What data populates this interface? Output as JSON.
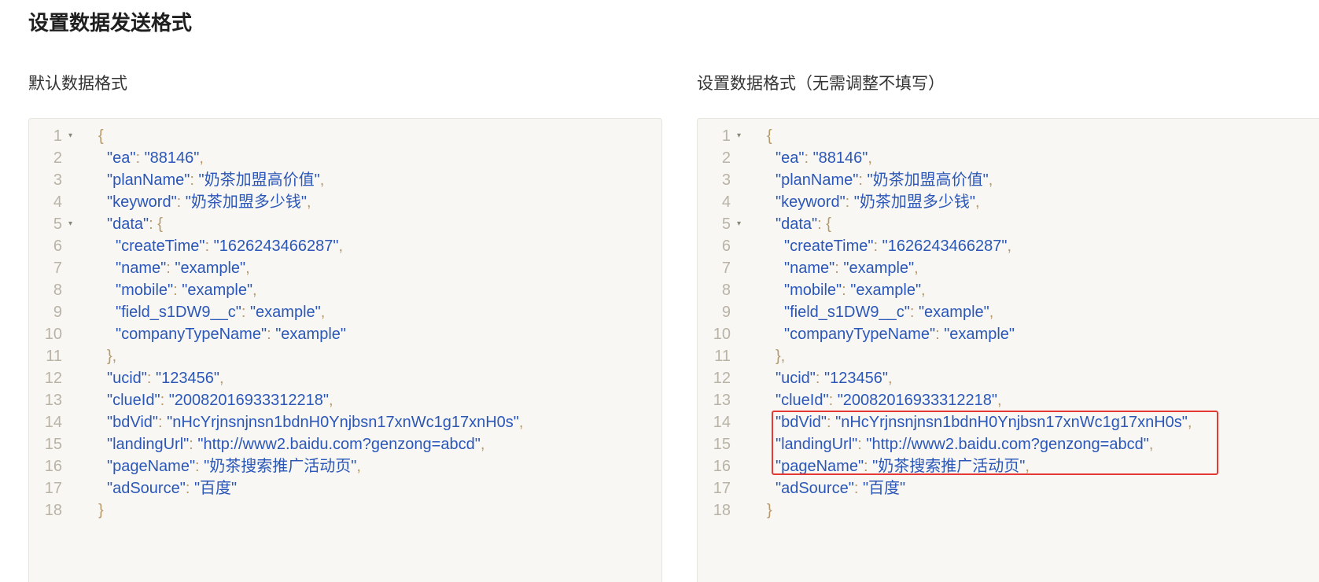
{
  "page": {
    "title": "设置数据发送格式"
  },
  "left_panel": {
    "label": "默认数据格式"
  },
  "right_panel": {
    "label": "设置数据格式（无需调整不填写）"
  },
  "highlight": {
    "color": "#e53935",
    "lines": [
      14,
      15,
      16
    ]
  },
  "colors": {
    "key": "#2b57b8",
    "punctuation": "#b79a6a",
    "line_number": "#b9b3a6",
    "editor_bg": "#f8f7f4"
  },
  "code_lines": [
    {
      "n": "1",
      "indent": 0,
      "fold": true,
      "key": "",
      "sep": "",
      "value": "",
      "open": "{",
      "trail": ""
    },
    {
      "n": "2",
      "indent": 1,
      "fold": false,
      "key": "\"ea\"",
      "sep": ": ",
      "value": "\"88146\"",
      "open": "",
      "trail": ","
    },
    {
      "n": "3",
      "indent": 1,
      "fold": false,
      "key": "\"planName\"",
      "sep": ": ",
      "value": "\"奶茶加盟高价值\"",
      "open": "",
      "trail": ","
    },
    {
      "n": "4",
      "indent": 1,
      "fold": false,
      "key": "\"keyword\"",
      "sep": ": ",
      "value": "\"奶茶加盟多少钱\"",
      "open": "",
      "trail": ","
    },
    {
      "n": "5",
      "indent": 1,
      "fold": true,
      "key": "\"data\"",
      "sep": ": ",
      "value": "",
      "open": "{",
      "trail": ""
    },
    {
      "n": "6",
      "indent": 2,
      "fold": false,
      "key": "\"createTime\"",
      "sep": ": ",
      "value": "\"1626243466287\"",
      "open": "",
      "trail": ","
    },
    {
      "n": "7",
      "indent": 2,
      "fold": false,
      "key": "\"name\"",
      "sep": ": ",
      "value": "\"example\"",
      "open": "",
      "trail": ","
    },
    {
      "n": "8",
      "indent": 2,
      "fold": false,
      "key": "\"mobile\"",
      "sep": ": ",
      "value": "\"example\"",
      "open": "",
      "trail": ","
    },
    {
      "n": "9",
      "indent": 2,
      "fold": false,
      "key": "\"field_s1DW9__c\"",
      "sep": ": ",
      "value": "\"example\"",
      "open": "",
      "trail": ","
    },
    {
      "n": "10",
      "indent": 2,
      "fold": false,
      "key": "\"companyTypeName\"",
      "sep": ": ",
      "value": "\"example\"",
      "open": "",
      "trail": ""
    },
    {
      "n": "11",
      "indent": 1,
      "fold": false,
      "key": "",
      "sep": "",
      "value": "",
      "open": "},",
      "trail": ""
    },
    {
      "n": "12",
      "indent": 1,
      "fold": false,
      "key": "\"ucid\"",
      "sep": ": ",
      "value": "\"123456\"",
      "open": "",
      "trail": ","
    },
    {
      "n": "13",
      "indent": 1,
      "fold": false,
      "key": "\"clueId\"",
      "sep": ": ",
      "value": "\"20082016933312218\"",
      "open": "",
      "trail": ","
    },
    {
      "n": "14",
      "indent": 1,
      "fold": false,
      "key": "\"bdVid\"",
      "sep": ": ",
      "value": "\"nHcYrjnsnjnsn1bdnH0Ynjbsn17xnWc1g17xnH0s\"",
      "open": "",
      "trail": ","
    },
    {
      "n": "15",
      "indent": 1,
      "fold": false,
      "key": "\"landingUrl\"",
      "sep": ": ",
      "value": "\"http://www2.baidu.com?genzong=abcd\"",
      "open": "",
      "trail": ","
    },
    {
      "n": "16",
      "indent": 1,
      "fold": false,
      "key": "\"pageName\"",
      "sep": ": ",
      "value": "\"奶茶搜索推广活动页\"",
      "open": "",
      "trail": ","
    },
    {
      "n": "17",
      "indent": 1,
      "fold": false,
      "key": "\"adSource\"",
      "sep": ": ",
      "value": "\"百度\"",
      "open": "",
      "trail": ""
    },
    {
      "n": "18",
      "indent": 0,
      "fold": false,
      "key": "",
      "sep": "",
      "value": "",
      "open": "}",
      "trail": ""
    }
  ]
}
